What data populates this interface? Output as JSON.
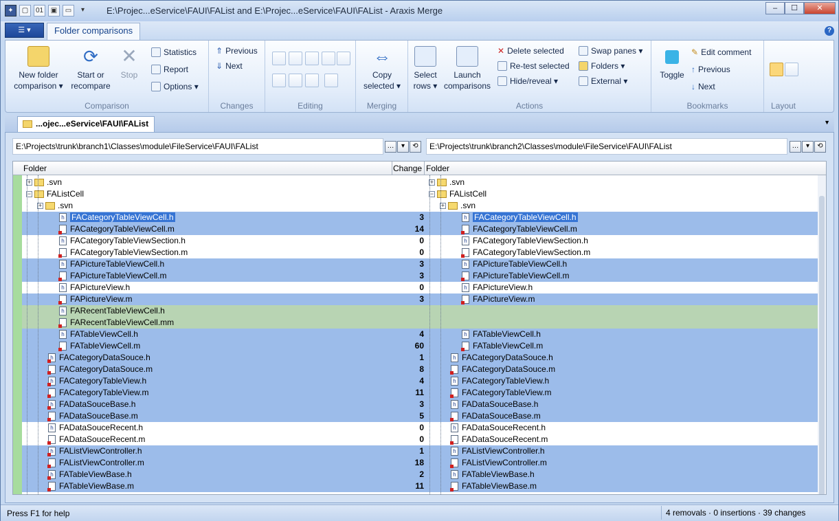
{
  "window": {
    "title": "E:\\Projec...eService\\FAUI\\FAList and E:\\Projec...eService\\FAUI\\FAList - Araxis Merge",
    "min": "–",
    "max": "☐",
    "close": "✕"
  },
  "ribbon_tab": "Folder comparisons",
  "app_button": "☰ ▾",
  "help": "?",
  "groups": {
    "comparison": {
      "label": "Comparison",
      "new_folder": "New folder",
      "comparison": "comparison ▾",
      "start": "Start or",
      "recompare": "recompare",
      "stop": "Stop",
      "statistics": "Statistics",
      "report": "Report",
      "options": "Options ▾"
    },
    "changes": {
      "label": "Changes",
      "previous": "Previous",
      "next": "Next"
    },
    "editing": {
      "label": "Editing"
    },
    "merging": {
      "label": "Merging",
      "copy": "Copy",
      "selected": "selected ▾"
    },
    "actions": {
      "label": "Actions",
      "select": "Select",
      "rows": "rows ▾",
      "launch": "Launch",
      "comparisons": "comparisons",
      "delete_selected": "Delete selected",
      "retest_selected": "Re-test selected",
      "hide_reveal": "Hide/reveal ▾",
      "swap_panes": "Swap panes ▾",
      "folders": "Folders ▾",
      "external": "External ▾"
    },
    "bookmarks": {
      "label": "Bookmarks",
      "toggle": "Toggle",
      "edit_comment": "Edit comment",
      "previous": "Previous",
      "next": "Next"
    },
    "layout": {
      "label": "Layout"
    }
  },
  "doc_tab": "...ojec...eService\\FAUI\\FAList",
  "left_path": "E:\\Projects\\trunk\\branch1\\Classes\\module\\FileService\\FAUI\\FAList",
  "right_path": "E:\\Projects\\trunk\\branch2\\Classes\\module\\FileService\\FAUI\\FAList",
  "headers": {
    "folder_left": "Folder",
    "change": "Change",
    "folder_right": "Folder"
  },
  "rows": [
    {
      "name": "FAListCell_svn",
      "left": ".svn",
      "right": ".svn",
      "change": "",
      "type": "folder",
      "indent": 0,
      "bg": "w",
      "pm": "+"
    },
    {
      "name": "FAListCell",
      "left": "FAListCell",
      "right": "FAListCell",
      "change": "",
      "type": "folder",
      "indent": 0,
      "bg": "w",
      "pm": "-"
    },
    {
      "name": "svn",
      "left": ".svn",
      "right": ".svn",
      "change": "",
      "type": "folder",
      "indent": 1,
      "bg": "w",
      "pm": "+"
    },
    {
      "name": "r1",
      "left": "FACategoryTableViewCell.h",
      "right": "FACategoryTableViewCell.h",
      "change": "3",
      "type": "h",
      "indent": 2,
      "bg": "b",
      "sel": true
    },
    {
      "name": "r2",
      "left": "FACategoryTableViewCell.m",
      "right": "FACategoryTableViewCell.m",
      "change": "14",
      "type": "m",
      "indent": 2,
      "bg": "b"
    },
    {
      "name": "r3",
      "left": "FACategoryTableViewSection.h",
      "right": "FACategoryTableViewSection.h",
      "change": "0",
      "type": "h",
      "indent": 2,
      "bg": "w"
    },
    {
      "name": "r4",
      "left": "FACategoryTableViewSection.m",
      "right": "FACategoryTableViewSection.m",
      "change": "0",
      "type": "m",
      "indent": 2,
      "bg": "w"
    },
    {
      "name": "r5",
      "left": "FAPictureTableViewCell.h",
      "right": "FAPictureTableViewCell.h",
      "change": "3",
      "type": "h",
      "indent": 2,
      "bg": "b"
    },
    {
      "name": "r6",
      "left": "FAPictureTableViewCell.m",
      "right": "FAPictureTableViewCell.m",
      "change": "3",
      "type": "m",
      "indent": 2,
      "bg": "b"
    },
    {
      "name": "r7",
      "left": "FAPictureView.h",
      "right": "FAPictureView.h",
      "change": "0",
      "type": "h",
      "indent": 2,
      "bg": "w"
    },
    {
      "name": "r8",
      "left": "FAPictureView.m",
      "right": "FAPictureView.m",
      "change": "3",
      "type": "m",
      "indent": 2,
      "bg": "b"
    },
    {
      "name": "r9",
      "left": "FARecentTableViewCell.h",
      "right": "",
      "change": "",
      "type": "h",
      "indent": 2,
      "bg": "g"
    },
    {
      "name": "r10",
      "left": "FARecentTableViewCell.mm",
      "right": "",
      "change": "",
      "type": "m",
      "indent": 2,
      "bg": "g"
    },
    {
      "name": "r11",
      "left": "FATableViewCell.h",
      "right": "FATableViewCell.h",
      "change": "4",
      "type": "h",
      "indent": 2,
      "bg": "b"
    },
    {
      "name": "r12",
      "left": "FATableViewCell.m",
      "right": "FATableViewCell.m",
      "change": "60",
      "type": "m",
      "indent": 2,
      "bg": "b"
    },
    {
      "name": "r13",
      "left": "FACategoryDataSouce.h",
      "right": "FACategoryDataSouce.h",
      "change": "1",
      "type": "h",
      "indent": 1,
      "bg": "b"
    },
    {
      "name": "r14",
      "left": "FACategoryDataSouce.m",
      "right": "FACategoryDataSouce.m",
      "change": "8",
      "type": "m",
      "indent": 1,
      "bg": "b"
    },
    {
      "name": "r15",
      "left": "FACategoryTableView.h",
      "right": "FACategoryTableView.h",
      "change": "4",
      "type": "h",
      "indent": 1,
      "bg": "b"
    },
    {
      "name": "r16",
      "left": "FACategoryTableView.m",
      "right": "FACategoryTableView.m",
      "change": "11",
      "type": "m",
      "indent": 1,
      "bg": "b"
    },
    {
      "name": "r17",
      "left": "FADataSouceBase.h",
      "right": "FADataSouceBase.h",
      "change": "3",
      "type": "h",
      "indent": 1,
      "bg": "b"
    },
    {
      "name": "r18",
      "left": "FADataSouceBase.m",
      "right": "FADataSouceBase.m",
      "change": "5",
      "type": "m",
      "indent": 1,
      "bg": "b"
    },
    {
      "name": "r19",
      "left": "FADataSouceRecent.h",
      "right": "FADataSouceRecent.h",
      "change": "0",
      "type": "h",
      "indent": 1,
      "bg": "w"
    },
    {
      "name": "r20",
      "left": "FADataSouceRecent.m",
      "right": "FADataSouceRecent.m",
      "change": "0",
      "type": "m",
      "indent": 1,
      "bg": "w"
    },
    {
      "name": "r21",
      "left": "FAListViewController.h",
      "right": "FAListViewController.h",
      "change": "1",
      "type": "h",
      "indent": 1,
      "bg": "b"
    },
    {
      "name": "r22",
      "left": "FAListViewController.m",
      "right": "FAListViewController.m",
      "change": "18",
      "type": "m",
      "indent": 1,
      "bg": "b"
    },
    {
      "name": "r23",
      "left": "FATableViewBase.h",
      "right": "FATableViewBase.h",
      "change": "2",
      "type": "h",
      "indent": 1,
      "bg": "b"
    },
    {
      "name": "r24",
      "left": "FATableViewBase.m",
      "right": "FATableViewBase.m",
      "change": "11",
      "type": "m",
      "indent": 1,
      "bg": "b"
    }
  ],
  "status": {
    "help": "Press F1 for help",
    "summary": "4 removals · 0 insertions · 39 changes"
  }
}
